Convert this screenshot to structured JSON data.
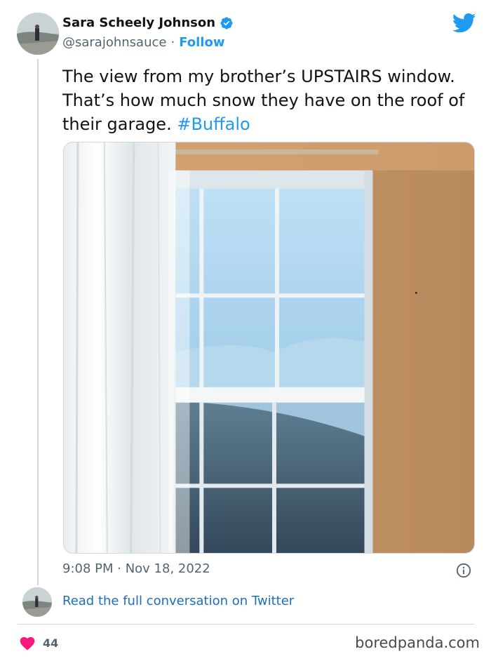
{
  "author": {
    "display_name": "Sara Scheely Johnson",
    "handle": "@sarajohnsauce",
    "separator": "·",
    "follow_label": "Follow",
    "verified": true
  },
  "tweet": {
    "text": "The view from my brother’s UPSTAIRS window. That’s how much snow they have on the roof of their garage. ",
    "hashtag": "#Buffalo",
    "timestamp": "9:08 PM · Nov 18, 2022",
    "likes": "44"
  },
  "conversation_link": "Read the full conversation on Twitter",
  "watermark": "boredpanda.com",
  "icons": {
    "bird": "twitter-bird-icon",
    "verified": "verified-badge-icon",
    "info": "info-icon",
    "heart": "heart-icon"
  },
  "colors": {
    "twitter_blue": "#1d9bf0",
    "heart_pink": "#f91880",
    "muted_text": "#536471"
  }
}
